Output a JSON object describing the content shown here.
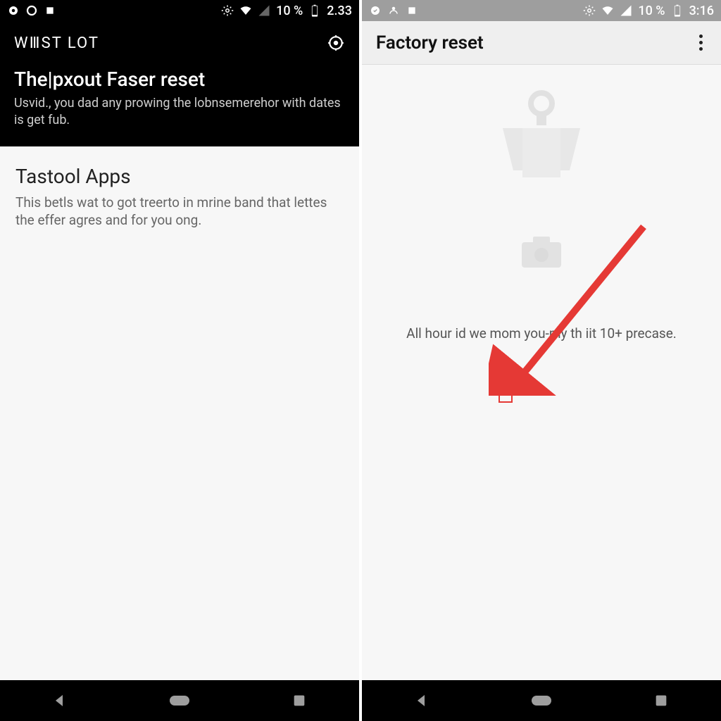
{
  "left": {
    "status": {
      "battery": "10 %",
      "time": "2.33"
    },
    "brand": "WⅢST LOT",
    "title": "The|pxout Faser reset",
    "subtitle": "Usvid., you dad any prowing the lobnsemerehor with dates is get fub.",
    "section_title": "Tastool Apps",
    "section_body": "This betls wat to got treerto in mrine band that lettes the effer agres and for you ong."
  },
  "right": {
    "status": {
      "battery": "10 %",
      "time": "3:16"
    },
    "title": "Factory reset",
    "body_text": "All hour id we mom you-my th iit 10+ precase."
  }
}
